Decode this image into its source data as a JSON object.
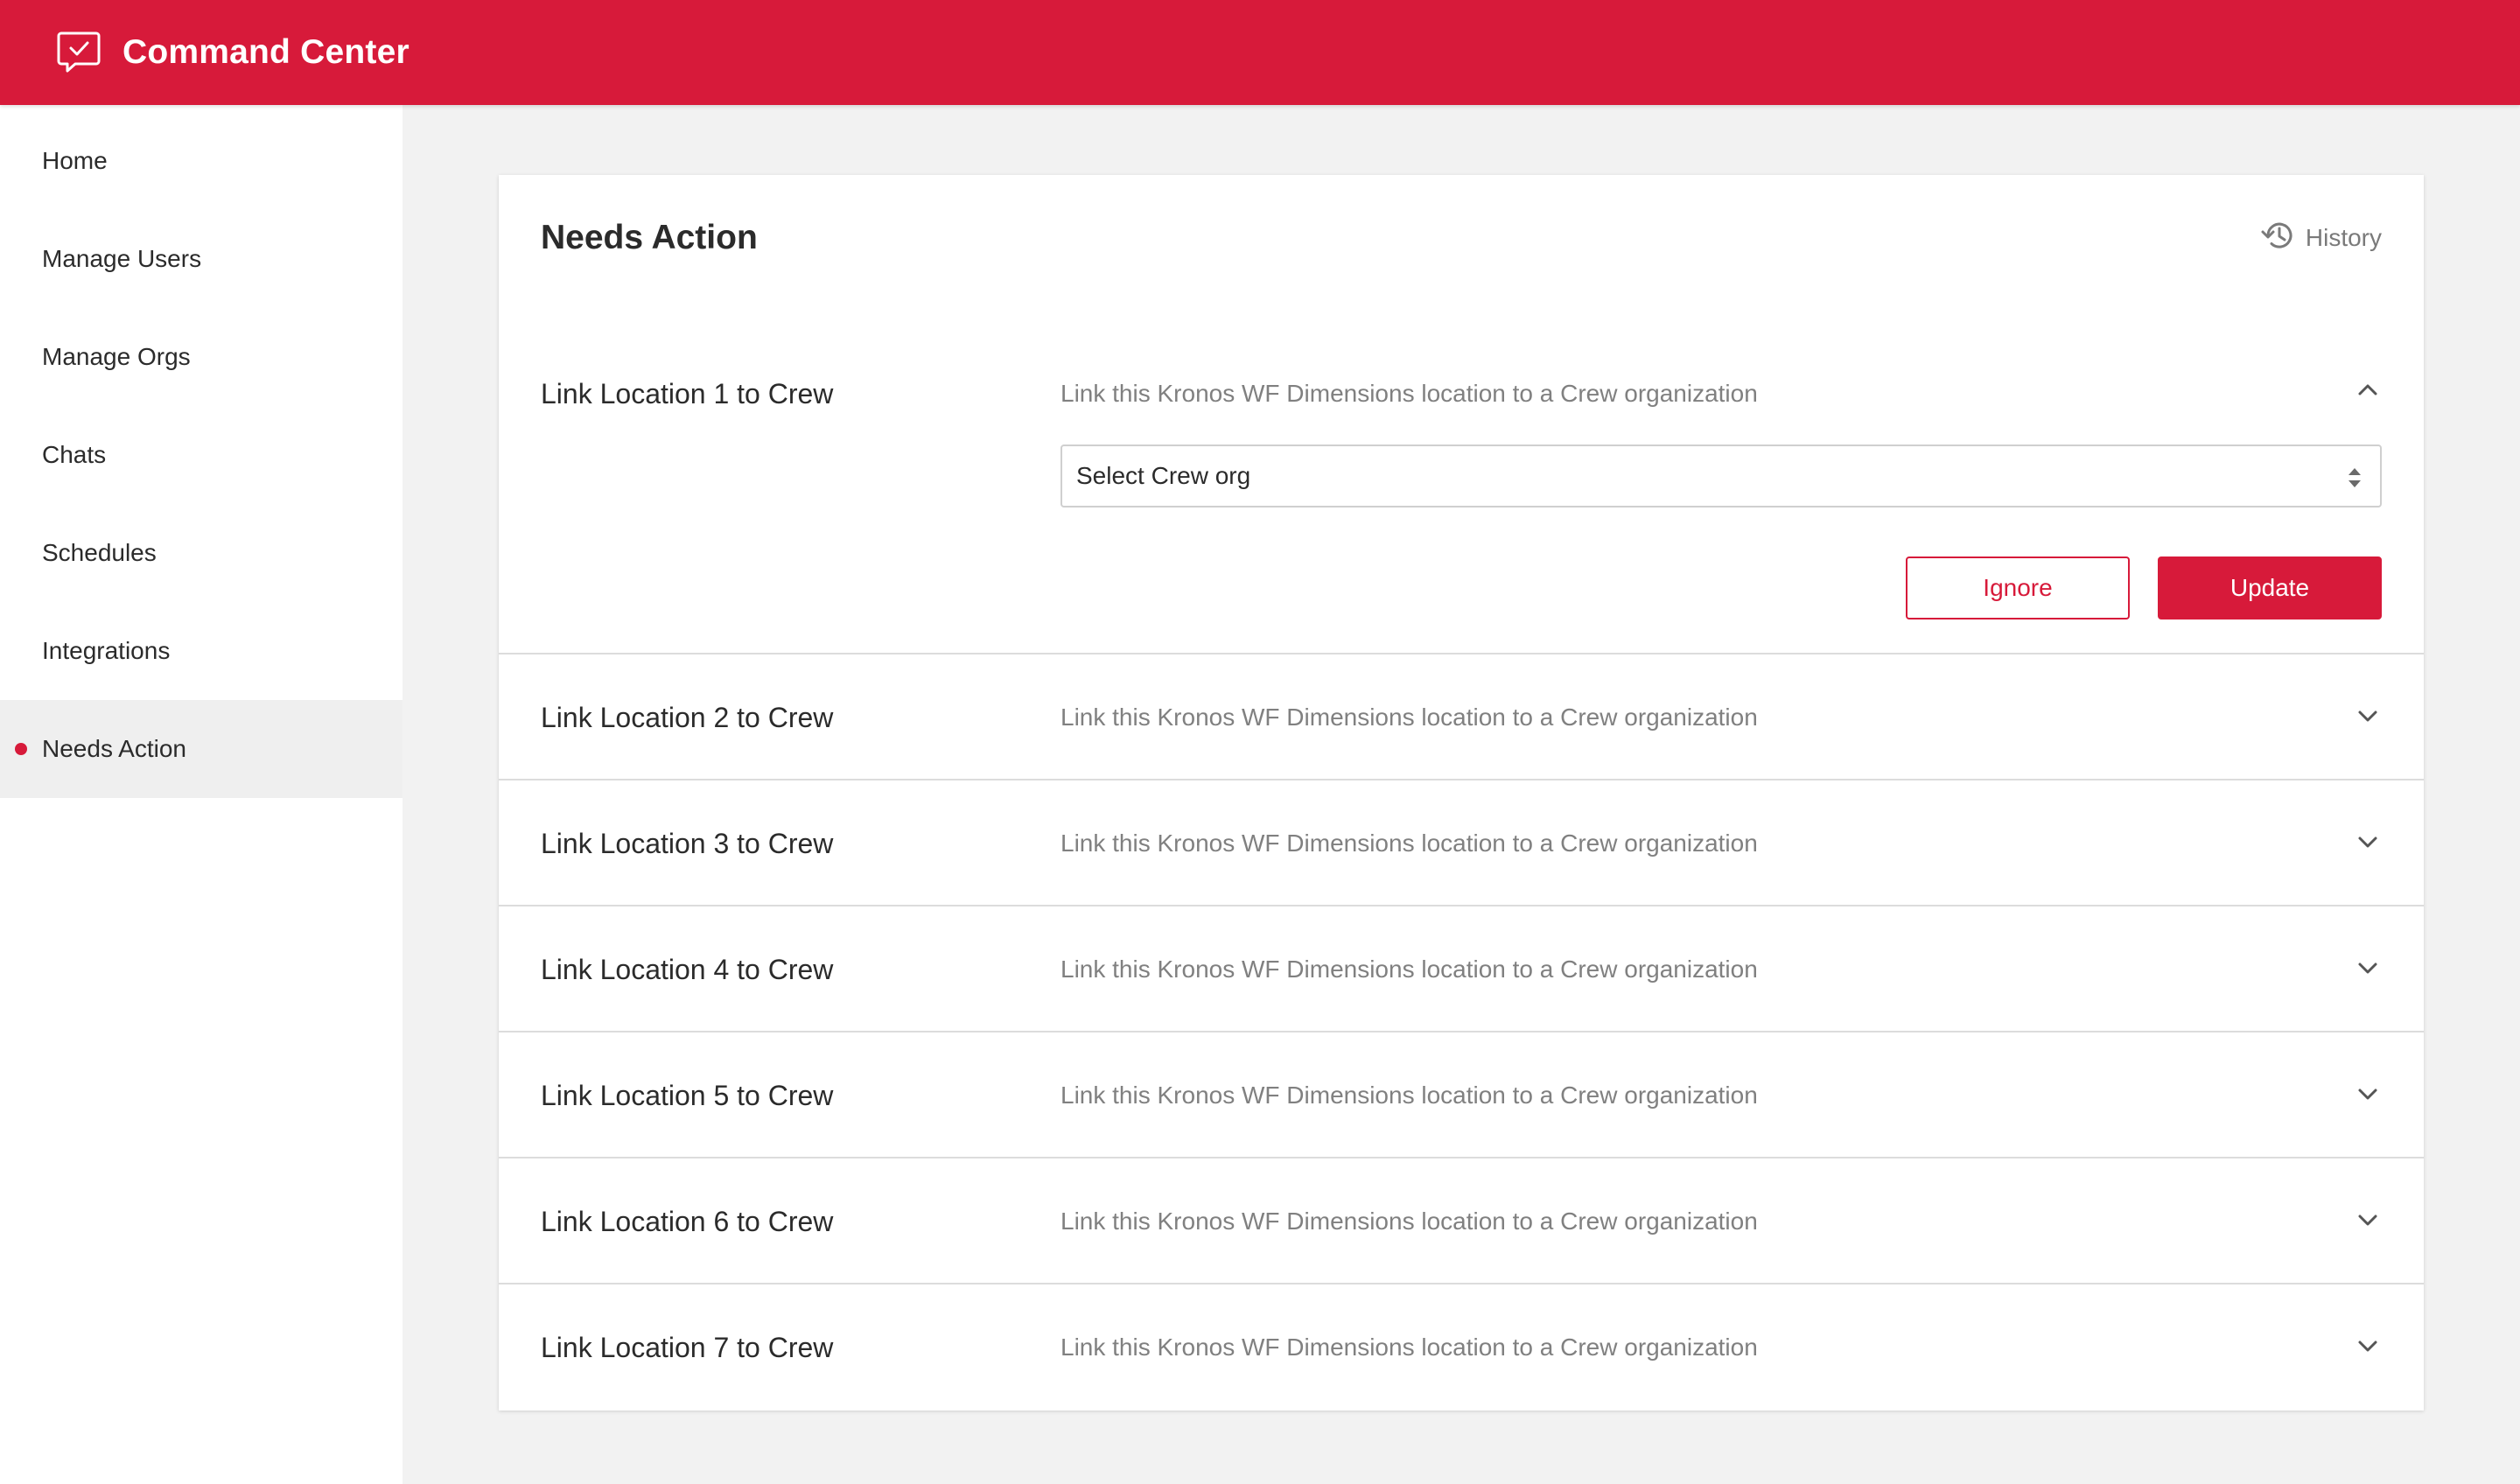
{
  "app": {
    "title": "Command Center",
    "logo_icon": "chat-check-icon"
  },
  "colors": {
    "brand": "#d71a3a",
    "text": "#2b2b2b",
    "muted": "#808080"
  },
  "sidebar": {
    "items": [
      {
        "label": "Home"
      },
      {
        "label": "Manage Users"
      },
      {
        "label": "Manage Orgs"
      },
      {
        "label": "Chats"
      },
      {
        "label": "Schedules"
      },
      {
        "label": "Integrations"
      },
      {
        "label": "Needs Action",
        "active": true
      }
    ]
  },
  "main": {
    "title": "Needs Action",
    "history_label": "History",
    "rows": [
      {
        "title": "Link Location 1 to Crew",
        "description": "Link this Kronos WF Dimensions location to a Crew organization",
        "expanded": true
      },
      {
        "title": "Link Location 2 to Crew",
        "description": "Link this Kronos WF Dimensions location to a Crew organization",
        "expanded": false
      },
      {
        "title": "Link Location 3 to Crew",
        "description": "Link this Kronos WF Dimensions location to a Crew organization",
        "expanded": false
      },
      {
        "title": "Link Location 4 to Crew",
        "description": "Link this Kronos WF Dimensions location to a Crew organization",
        "expanded": false
      },
      {
        "title": "Link Location 5 to Crew",
        "description": "Link this Kronos WF Dimensions location to a Crew organization",
        "expanded": false
      },
      {
        "title": "Link Location 6 to Crew",
        "description": "Link this Kronos WF Dimensions location to a Crew organization",
        "expanded": false
      },
      {
        "title": "Link Location 7 to Crew",
        "description": "Link this Kronos WF Dimensions location to a Crew organization",
        "expanded": false
      }
    ],
    "select": {
      "value": "Select Crew org"
    },
    "buttons": {
      "ignore": "Ignore",
      "update": "Update"
    }
  }
}
